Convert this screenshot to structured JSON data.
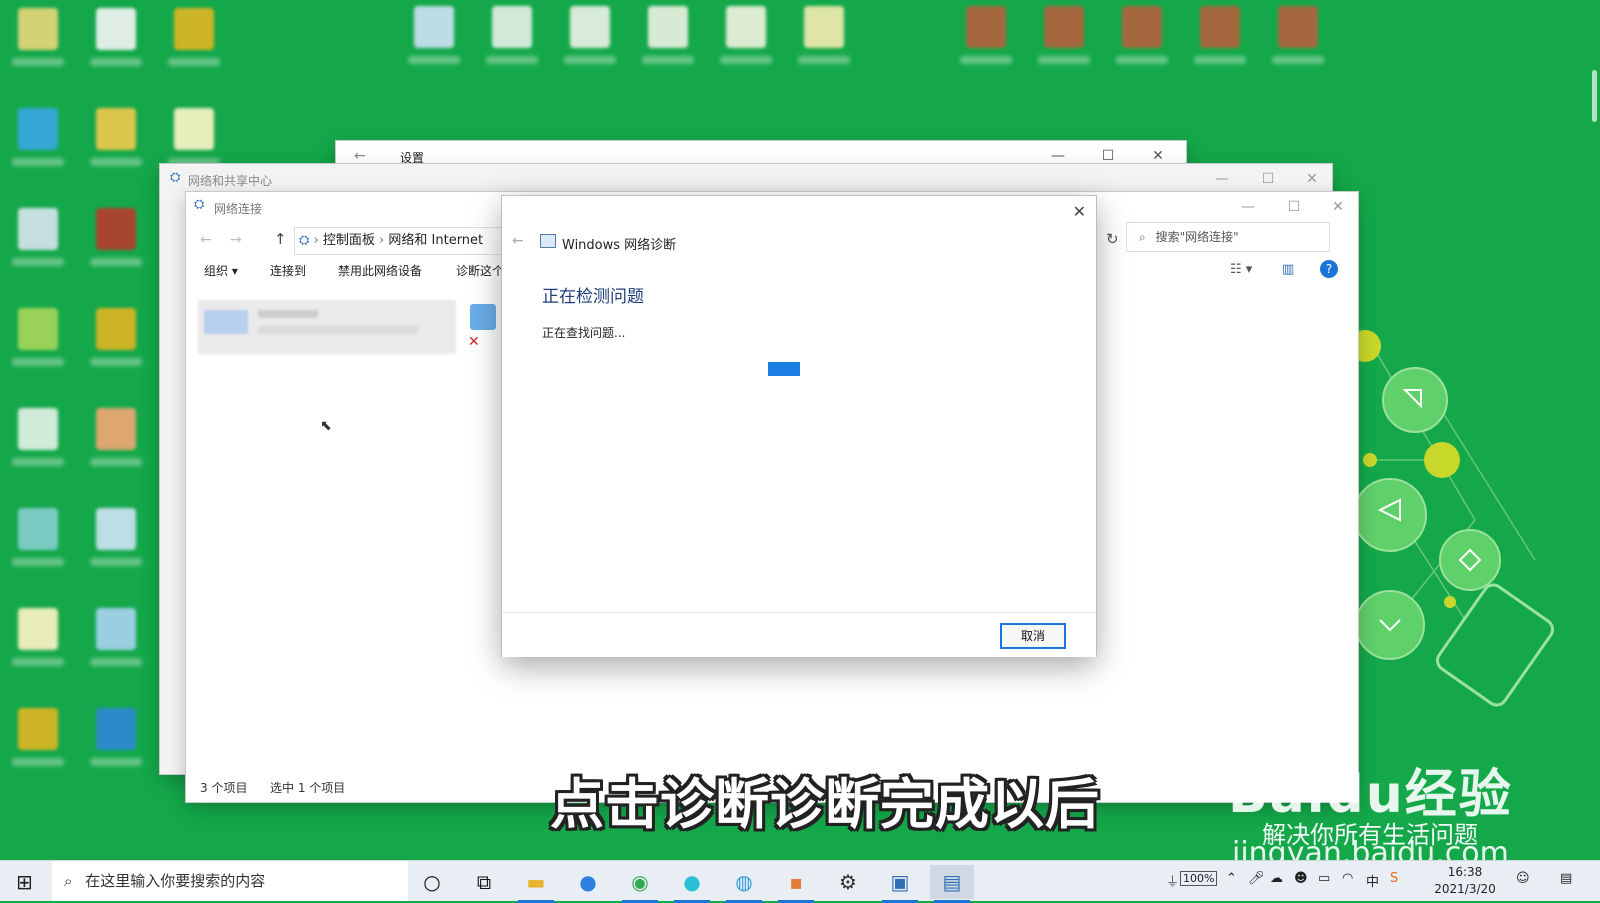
{
  "desktop": {
    "background": "#14a84a"
  },
  "windows": {
    "settings": {
      "title": "设置"
    },
    "network_center": {
      "title": "网络和共享中心"
    },
    "explorer": {
      "title": "网络连接",
      "breadcrumb": [
        "控制面板",
        "网络和 Internet"
      ],
      "search_placeholder": "搜索\"网络连接\"",
      "toolbar": {
        "organize": "组织",
        "connect": "连接到",
        "disable": "禁用此网络设备",
        "diagnose": "诊断这个"
      },
      "status": {
        "count": "3 个项目",
        "selected": "选中 1 个项目"
      }
    }
  },
  "dialog": {
    "title": "Windows 网络诊断",
    "heading": "正在检测问题",
    "status": "正在查找问题...",
    "progress_state": "indeterminate",
    "cancel_label": "取消"
  },
  "overlay": {
    "subtitle": "点击诊断诊断完成以后",
    "watermark_brand": "Baidu经验",
    "watermark_slogan": "解决你所有生活问题",
    "watermark_url": "jingyan.baidu.com"
  },
  "taskbar": {
    "search_placeholder": "在这里输入你要搜索的内容",
    "battery": "100%",
    "ime": "中",
    "time": "16:38",
    "date": "2021/3/20"
  },
  "colors": {
    "accent": "#1b7fe6",
    "heading": "#1e3d7b"
  }
}
